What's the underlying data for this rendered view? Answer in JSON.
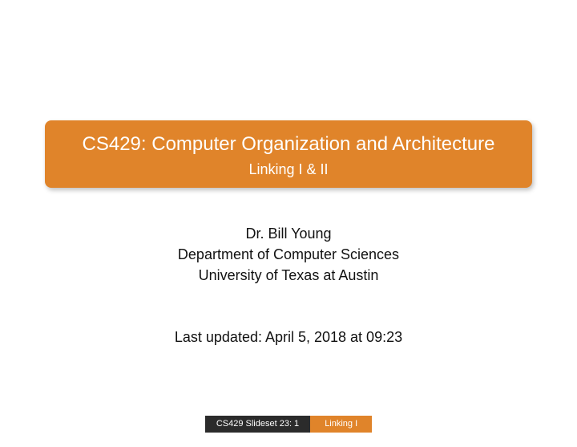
{
  "title": {
    "main": "CS429: Computer Organization and Architecture",
    "sub": "Linking I & II"
  },
  "author": {
    "name": "Dr. Bill Young",
    "department": "Department of Computer Sciences",
    "university": "University of Texas at Austin"
  },
  "updated": "Last updated: April 5, 2018 at 09:23",
  "footer": {
    "left": "CS429 Slideset 23: 1",
    "right": "Linking I"
  }
}
